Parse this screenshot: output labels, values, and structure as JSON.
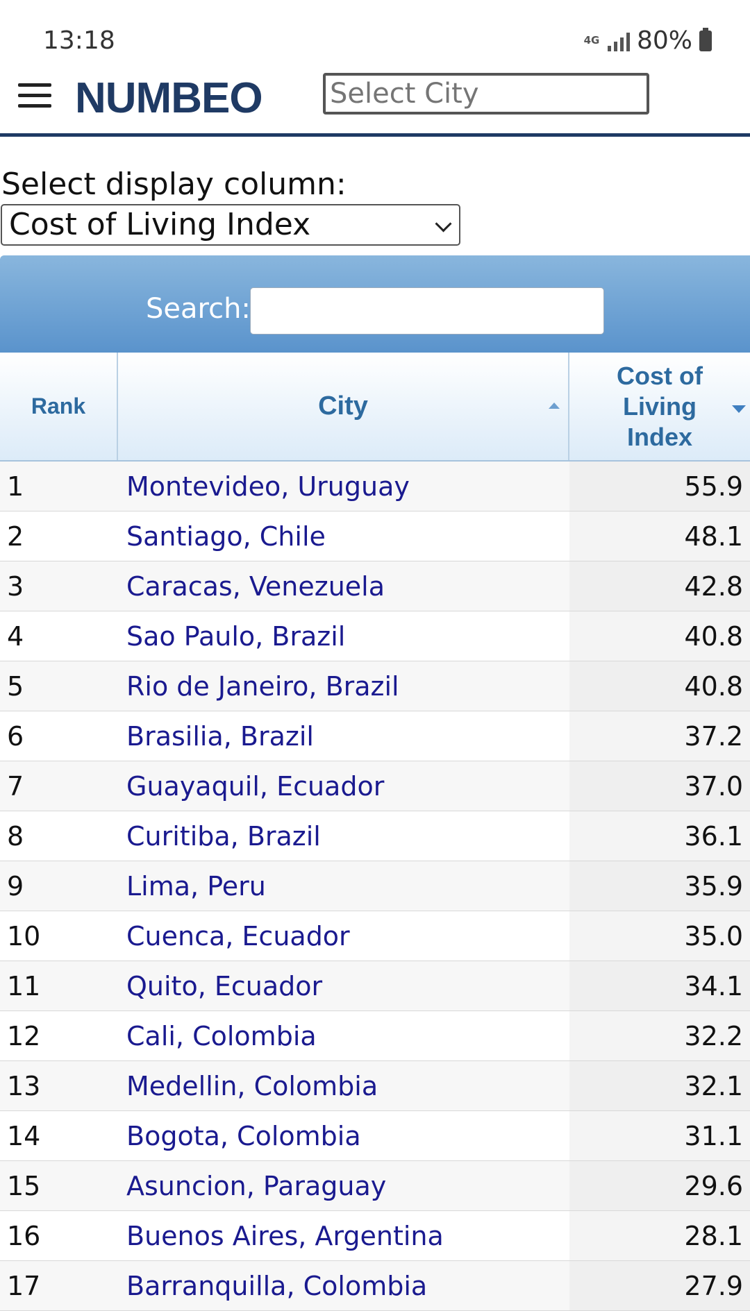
{
  "status_bar": {
    "time": "13:18",
    "network": "4G",
    "battery_pct": "80%",
    "icons": [
      "network-4g-icon",
      "signal-icon",
      "battery-icon"
    ]
  },
  "header": {
    "logo": "NUMBEO",
    "city_select_placeholder": "Select City",
    "brand_color": "#1f3a64"
  },
  "display_column": {
    "label": "Select display column:",
    "selected": "Cost of Living Index"
  },
  "search": {
    "label": "Search:",
    "value": ""
  },
  "table": {
    "headers": {
      "rank": "Rank",
      "city": "City",
      "cost": "Cost of Living Index"
    },
    "rows": [
      {
        "rank": "1",
        "city": "Montevideo, Uruguay",
        "value": "55.9"
      },
      {
        "rank": "2",
        "city": "Santiago, Chile",
        "value": "48.1"
      },
      {
        "rank": "3",
        "city": "Caracas, Venezuela",
        "value": "42.8"
      },
      {
        "rank": "4",
        "city": "Sao Paulo, Brazil",
        "value": "40.8"
      },
      {
        "rank": "5",
        "city": "Rio de Janeiro, Brazil",
        "value": "40.8"
      },
      {
        "rank": "6",
        "city": "Brasilia, Brazil",
        "value": "37.2"
      },
      {
        "rank": "7",
        "city": "Guayaquil, Ecuador",
        "value": "37.0"
      },
      {
        "rank": "8",
        "city": "Curitiba, Brazil",
        "value": "36.1"
      },
      {
        "rank": "9",
        "city": "Lima, Peru",
        "value": "35.9"
      },
      {
        "rank": "10",
        "city": "Cuenca, Ecuador",
        "value": "35.0"
      },
      {
        "rank": "11",
        "city": "Quito, Ecuador",
        "value": "34.1"
      },
      {
        "rank": "12",
        "city": "Cali, Colombia",
        "value": "32.2"
      },
      {
        "rank": "13",
        "city": "Medellin, Colombia",
        "value": "32.1"
      },
      {
        "rank": "14",
        "city": "Bogota, Colombia",
        "value": "31.1"
      },
      {
        "rank": "15",
        "city": "Asuncion, Paraguay",
        "value": "29.6"
      },
      {
        "rank": "16",
        "city": "Buenos Aires, Argentina",
        "value": "28.1"
      },
      {
        "rank": "17",
        "city": "Barranquilla, Colombia",
        "value": "27.9"
      }
    ]
  }
}
